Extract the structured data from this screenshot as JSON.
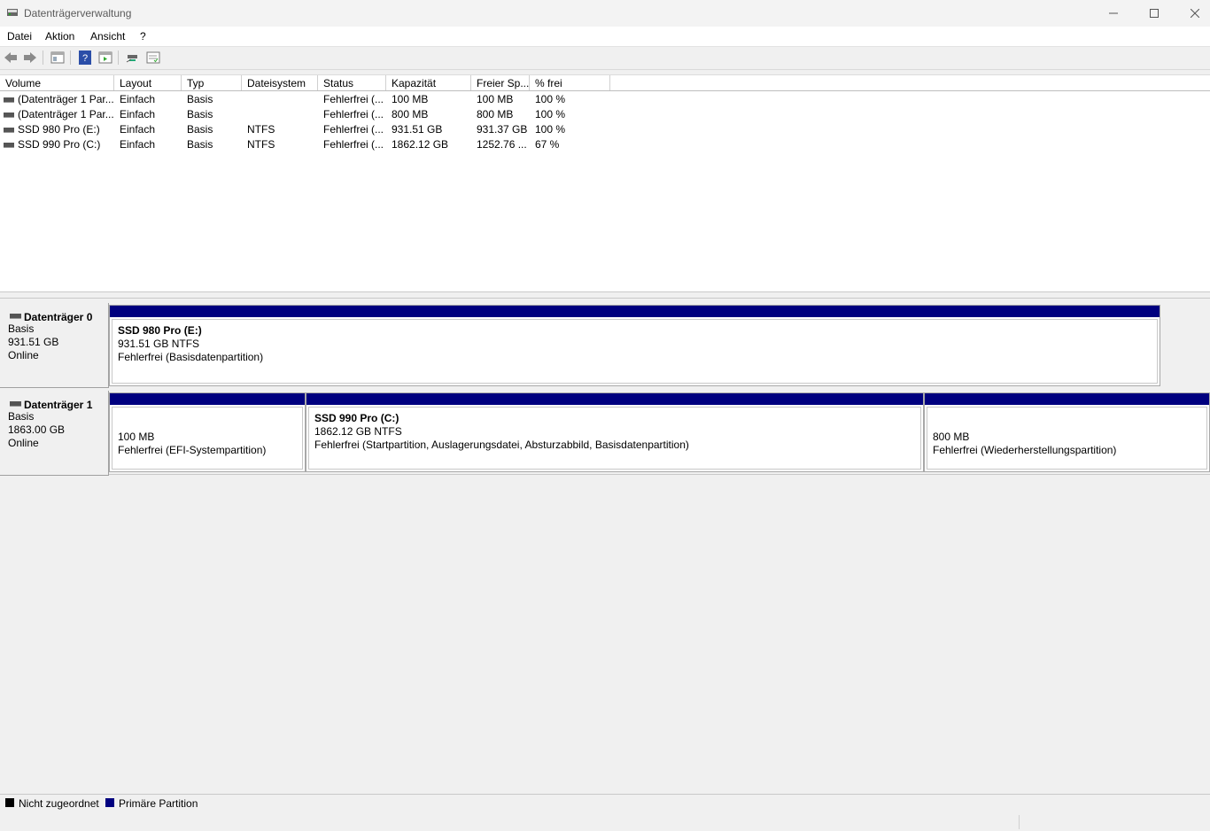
{
  "window": {
    "title": "Datenträgerverwaltung"
  },
  "menu": [
    "Datei",
    "Aktion",
    "Ansicht",
    "?"
  ],
  "toolbar": {
    "icons": [
      "back-arrow-icon",
      "forward-arrow-icon",
      "properties-icon",
      "help-icon",
      "view-icon",
      "connect-icon",
      "console-icon"
    ]
  },
  "table": {
    "headers": [
      "Volume",
      "Layout",
      "Typ",
      "Dateisystem",
      "Status",
      "Kapazität",
      "Freier Sp...",
      "% frei"
    ],
    "rows": [
      [
        "(Datenträger 1 Par...",
        "Einfach",
        "Basis",
        "",
        "Fehlerfrei (...",
        "100 MB",
        "100 MB",
        "100 %"
      ],
      [
        "(Datenträger 1 Par...",
        "Einfach",
        "Basis",
        "",
        "Fehlerfrei (...",
        "800 MB",
        "800 MB",
        "100 %"
      ],
      [
        "SSD 980 Pro (E:)",
        "Einfach",
        "Basis",
        "NTFS",
        "Fehlerfrei (...",
        "931.51 GB",
        "931.37 GB",
        "100 %"
      ],
      [
        "SSD 990 Pro (C:)",
        "Einfach",
        "Basis",
        "NTFS",
        "Fehlerfrei (...",
        "1862.12 GB",
        "1252.76 ...",
        "67 %"
      ]
    ]
  },
  "disks": [
    {
      "name": "Datenträger 0",
      "type": "Basis",
      "size": "931.51 GB",
      "state": "Online",
      "partitions": [
        {
          "title": "SSD 980 Pro  (E:)",
          "size": "931.51 GB NTFS",
          "status": "Fehlerfrei (Basisdatenpartition)"
        }
      ]
    },
    {
      "name": "Datenträger 1",
      "type": "Basis",
      "size": "1863.00 GB",
      "state": "Online",
      "partitions": [
        {
          "title": "",
          "size": "100 MB",
          "status": "Fehlerfrei (EFI-Systempartition)"
        },
        {
          "title": "SSD 990 Pro  (C:)",
          "size": "1862.12 GB NTFS",
          "status": "Fehlerfrei (Startpartition, Auslagerungsdatei, Absturzabbild, Basisdatenpartition)"
        },
        {
          "title": "",
          "size": "800 MB",
          "status": "Fehlerfrei (Wiederherstellungspartition)"
        }
      ]
    }
  ],
  "legend": [
    {
      "label": "Nicht zugeordnet",
      "color": "#000000"
    },
    {
      "label": "Primäre Partition",
      "color": "#00007f"
    }
  ]
}
